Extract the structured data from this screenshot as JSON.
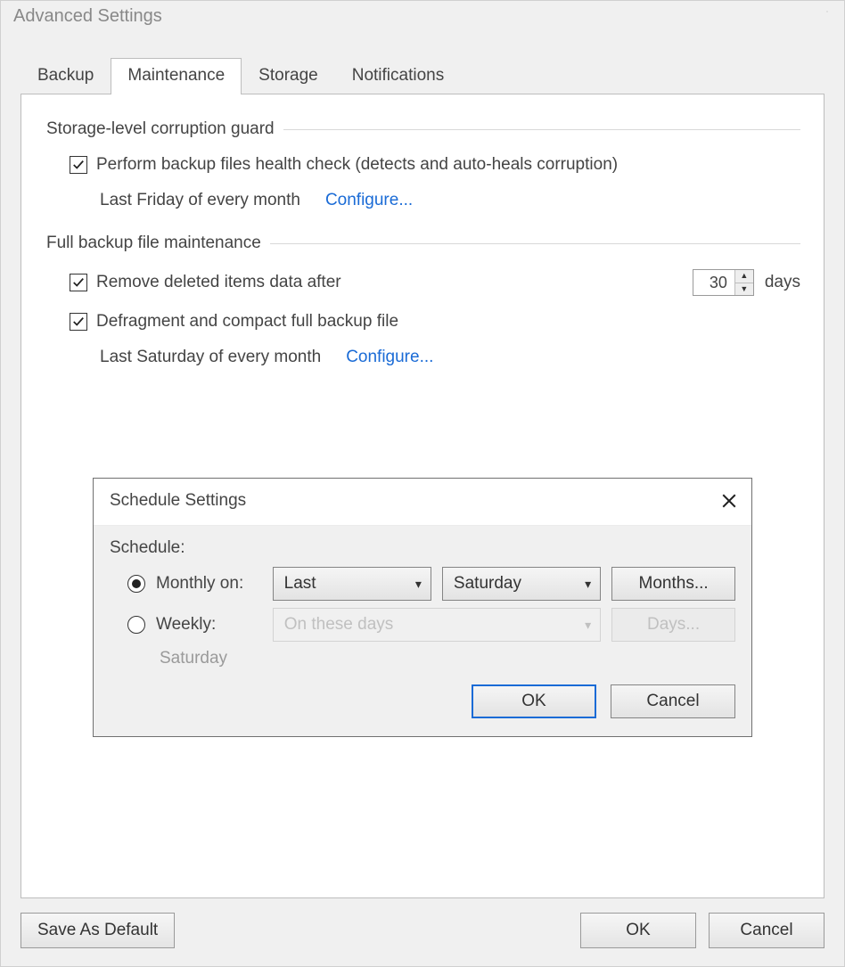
{
  "window": {
    "title": "Advanced Settings",
    "footer": {
      "save_default": "Save As Default",
      "ok": "OK",
      "cancel": "Cancel"
    }
  },
  "tabs": [
    "Backup",
    "Maintenance",
    "Storage",
    "Notifications"
  ],
  "active_tab_index": 1,
  "maintenance": {
    "group1_title": "Storage-level corruption guard",
    "healthcheck_label": "Perform backup files health check (detects and auto-heals corruption)",
    "healthcheck_checked": true,
    "healthcheck_schedule_text": "Last Friday of every month",
    "configure_link": "Configure...",
    "group2_title": "Full backup file maintenance",
    "remove_label": "Remove deleted items data after",
    "remove_checked": true,
    "remove_days_value": "30",
    "remove_days_suffix": "days",
    "defrag_label": "Defragment and compact full backup file",
    "defrag_checked": true,
    "defrag_schedule_text": "Last Saturday of every month"
  },
  "schedule_dialog": {
    "title": "Schedule Settings",
    "schedule_label": "Schedule:",
    "monthly_label": "Monthly on:",
    "monthly_selected": true,
    "ordinal_value": "Last",
    "day_value": "Saturday",
    "months_button": "Months...",
    "weekly_label": "Weekly:",
    "weekly_selected": false,
    "weekly_placeholder": "On these days",
    "days_button": "Days...",
    "days_summary": "Saturday",
    "ok": "OK",
    "cancel": "Cancel"
  }
}
